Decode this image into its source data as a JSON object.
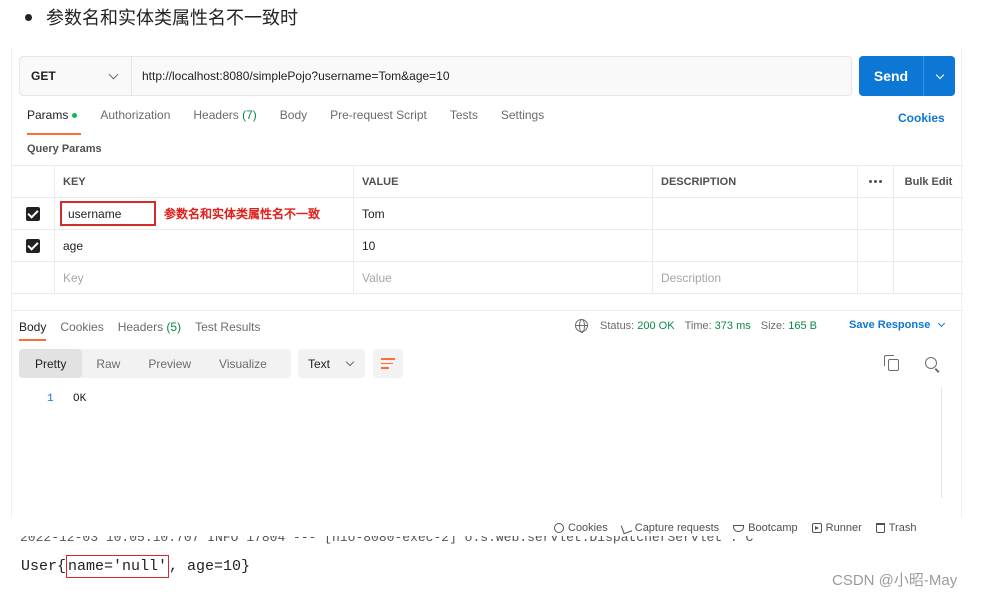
{
  "heading": "参数名和实体类属性名不一致时",
  "request": {
    "method": "GET",
    "url": "http://localhost:8080/simplePojo?username=Tom&age=10",
    "send_label": "Send"
  },
  "request_tabs": {
    "params": "Params",
    "authorization": "Authorization",
    "headers": "Headers",
    "headers_count": "(7)",
    "body": "Body",
    "prerequest": "Pre-request Script",
    "tests": "Tests",
    "settings": "Settings",
    "cookies": "Cookies"
  },
  "query_params": {
    "label": "Query Params",
    "columns": {
      "key": "KEY",
      "value": "VALUE",
      "description": "DESCRIPTION",
      "bulk_edit": "Bulk Edit"
    },
    "rows": [
      {
        "key": "username",
        "value": "Tom",
        "checked": true
      },
      {
        "key": "age",
        "value": "10",
        "checked": true
      }
    ],
    "placeholders": {
      "key": "Key",
      "value": "Value",
      "description": "Description"
    },
    "annotation": "参数名和实体类属性名不一致"
  },
  "response": {
    "tabs": {
      "body": "Body",
      "cookies": "Cookies",
      "headers": "Headers",
      "headers_count": "(5)",
      "test_results": "Test Results"
    },
    "status_label": "Status:",
    "status_value": "200 OK",
    "time_label": "Time:",
    "time_value": "373 ms",
    "size_label": "Size:",
    "size_value": "165 B",
    "save_response": "Save Response",
    "views": {
      "pretty": "Pretty",
      "raw": "Raw",
      "preview": "Preview",
      "visualize": "Visualize"
    },
    "format": "Text",
    "line_number": "1",
    "line_text": "OK"
  },
  "statusbar": {
    "cookies": "Cookies",
    "capture": "Capture requests",
    "bootcamp": "Bootcamp",
    "runner": "Runner",
    "trash": "Trash"
  },
  "console": {
    "cut_line": "2022-12-03 10:05:10.707  INFO 17804 --- [nio-8080-exec-2] o.s.web.servlet.DispatcherServlet        : C",
    "prefix": "User{",
    "highlight": "name='null'",
    "suffix": ", age=10}"
  },
  "watermark": "CSDN @小昭-May"
}
